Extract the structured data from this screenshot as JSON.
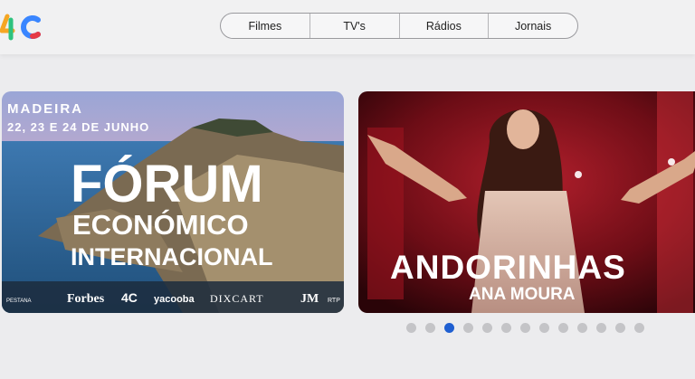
{
  "header": {
    "logo": {
      "text": "4C",
      "colors": [
        "#f5a623",
        "#3a86ff",
        "#e63946"
      ]
    },
    "nav": [
      "Filmes",
      "TV's",
      "Rádios",
      "Jornais"
    ]
  },
  "carousel": {
    "slides": [
      {
        "location": "MADEIRA",
        "dates": "22, 23 E 24 DE JUNHO",
        "title_line1": "FÓRUM",
        "title_line2": "ECONÓMICO",
        "title_line3": "INTERNACIONAL",
        "sponsors": [
          "PESTANA",
          "Forbes",
          "4C",
          "yacooba",
          "DIXCART",
          "JM",
          "RTP"
        ]
      },
      {
        "title": "ANDORINHAS",
        "artist": "ANA MOURA"
      }
    ],
    "dots": {
      "count": 13,
      "active_index": 2
    }
  }
}
